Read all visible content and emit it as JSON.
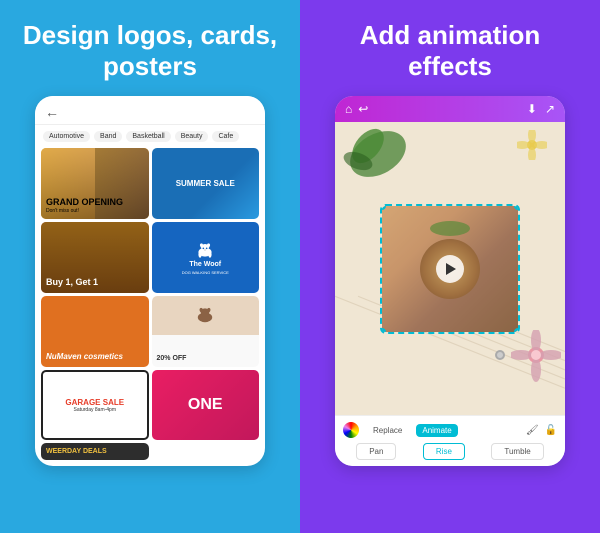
{
  "left": {
    "headline": "Design logos, cards, posters",
    "categories": [
      "Automotive",
      "Band",
      "Basketball",
      "Beauty",
      "Cafe"
    ],
    "cards": [
      {
        "id": "grand-opening",
        "text": "GRAND OPENING",
        "sub": "Don't miss out!"
      },
      {
        "id": "summer-sale",
        "text": "SUMMER SALE"
      },
      {
        "id": "buy1get1",
        "text": "Buy 1, Get 1"
      },
      {
        "id": "the-woof",
        "text": "The Woof",
        "sub": "DOG WALKING SERVICE"
      },
      {
        "id": "numaven",
        "text": "NuMaven cosmetics"
      },
      {
        "id": "20off",
        "text": "20% OFF"
      },
      {
        "id": "garage-sale",
        "text": "GARAGE SALE"
      },
      {
        "id": "one",
        "text": "ONE"
      },
      {
        "id": "weerday-deals",
        "text": "WEERDAY DEALS"
      }
    ]
  },
  "right": {
    "headline": "Add animation effects",
    "toolbar": {
      "replace_label": "Replace",
      "animate_label": "Animate",
      "animation_options": [
        "Pan",
        "Rise",
        "Tumble"
      ]
    }
  }
}
